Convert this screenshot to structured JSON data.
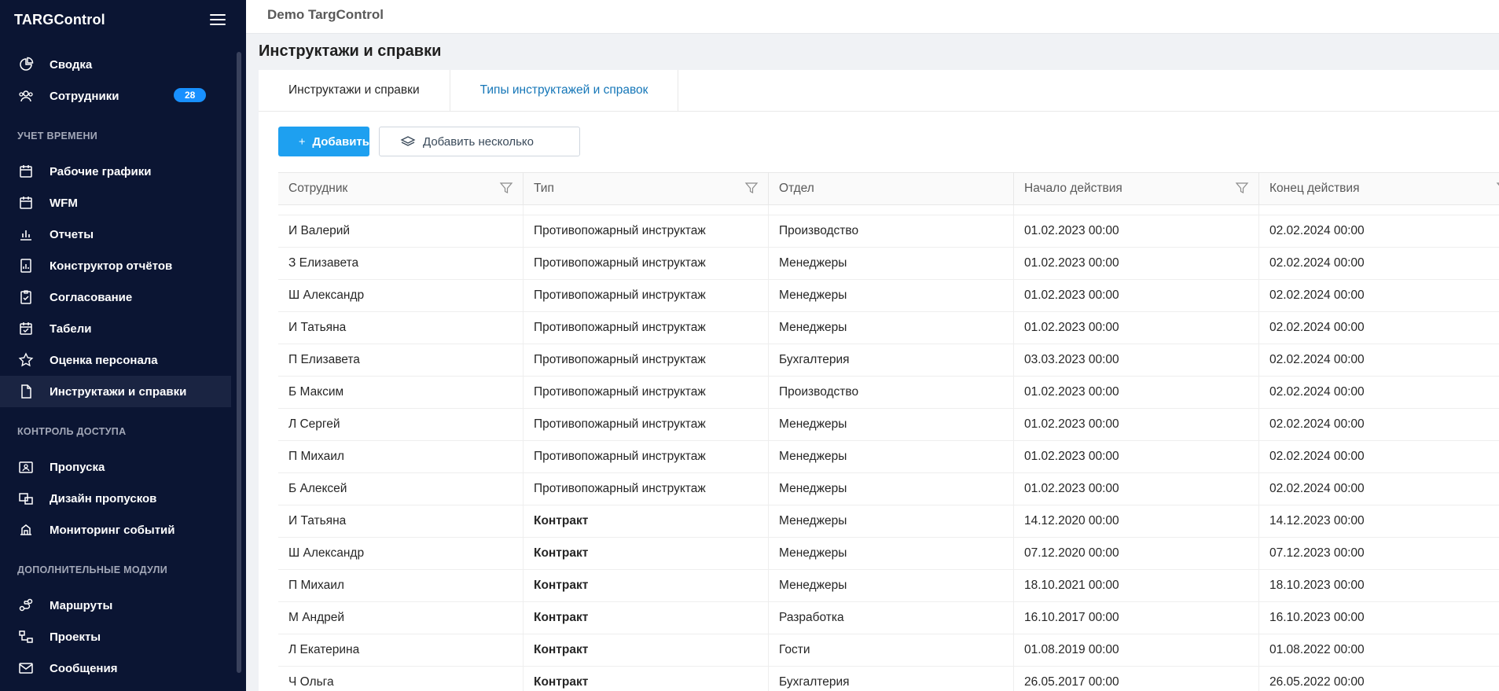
{
  "sidebar": {
    "logo": "TARGControl",
    "top_items": [
      {
        "label": "Сводка",
        "icon": "pie-chart-icon"
      },
      {
        "label": "Сотрудники",
        "icon": "users-icon",
        "badge": "28"
      }
    ],
    "sections": [
      {
        "title": "УЧЕТ ВРЕМЕНИ",
        "items": [
          {
            "label": "Рабочие графики",
            "icon": "calendar-icon"
          },
          {
            "label": "WFM",
            "icon": "calendar-icon"
          },
          {
            "label": "Отчеты",
            "icon": "bar-chart-icon"
          },
          {
            "label": "Конструктор отчётов",
            "icon": "report-builder-icon"
          },
          {
            "label": "Согласование",
            "icon": "checklist-icon"
          },
          {
            "label": "Табели",
            "icon": "calendar-check-icon"
          },
          {
            "label": "Оценка персонала",
            "icon": "star-icon"
          },
          {
            "label": "Инструктажи и справки",
            "icon": "document-icon"
          }
        ]
      },
      {
        "title": "КОНТРОЛЬ ДОСТУПА",
        "items": [
          {
            "label": "Пропуска",
            "icon": "id-card-icon"
          },
          {
            "label": "Дизайн пропусков",
            "icon": "design-icon"
          },
          {
            "label": "Мониторинг событий",
            "icon": "monitoring-icon"
          }
        ]
      },
      {
        "title": "ДОПОЛНИТЕЛЬНЫЕ МОДУЛИ",
        "items": [
          {
            "label": "Маршруты",
            "icon": "route-icon"
          },
          {
            "label": "Проекты",
            "icon": "project-icon"
          },
          {
            "label": "Сообщения",
            "icon": "mail-icon"
          }
        ]
      }
    ]
  },
  "header": {
    "app_name": "Demo TargControl"
  },
  "page": {
    "title": "Инструктажи и справки"
  },
  "tabs": [
    {
      "label": "Инструктажи и справки",
      "active": true
    },
    {
      "label": "Типы инструктажей и справок",
      "active": false
    }
  ],
  "toolbar": {
    "add_label": "Добавить",
    "add_many_label": "Добавить несколько"
  },
  "table": {
    "columns": [
      "Сотрудник",
      "Тип",
      "Отдел",
      "Начало действия",
      "Конец действия"
    ],
    "rows": [
      [
        "И Валерий",
        "Противопожарный инструктаж",
        "Производство",
        "01.02.2023 00:00",
        "02.02.2024 00:00"
      ],
      [
        "З Елизавета",
        "Противопожарный инструктаж",
        "Менеджеры",
        "01.02.2023 00:00",
        "02.02.2024 00:00"
      ],
      [
        "Ш Александр",
        "Противопожарный инструктаж",
        "Менеджеры",
        "01.02.2023 00:00",
        "02.02.2024 00:00"
      ],
      [
        "И Татьяна",
        "Противопожарный инструктаж",
        "Менеджеры",
        "01.02.2023 00:00",
        "02.02.2024 00:00"
      ],
      [
        "П Елизавета",
        "Противопожарный инструктаж",
        "Бухгалтерия",
        "03.03.2023 00:00",
        "02.02.2024 00:00"
      ],
      [
        "Б Максим",
        "Противопожарный инструктаж",
        "Производство",
        "01.02.2023 00:00",
        "02.02.2024 00:00"
      ],
      [
        "Л Сергей",
        "Противопожарный инструктаж",
        "Менеджеры",
        "01.02.2023 00:00",
        "02.02.2024 00:00"
      ],
      [
        "П Михаил",
        "Противопожарный инструктаж",
        "Менеджеры",
        "01.02.2023 00:00",
        "02.02.2024 00:00"
      ],
      [
        "Б Алексей",
        "Противопожарный инструктаж",
        "Менеджеры",
        "01.02.2023 00:00",
        "02.02.2024 00:00"
      ],
      [
        "И Татьяна",
        "Контракт",
        "Менеджеры",
        "14.12.2020 00:00",
        "14.12.2023 00:00"
      ],
      [
        "Ш Александр",
        "Контракт",
        "Менеджеры",
        "07.12.2020 00:00",
        "07.12.2023 00:00"
      ],
      [
        "П Михаил",
        "Контракт",
        "Менеджеры",
        "18.10.2021 00:00",
        "18.10.2023 00:00"
      ],
      [
        "М Андрей",
        "Контракт",
        "Разработка",
        "16.10.2017 00:00",
        "16.10.2023 00:00"
      ],
      [
        "Л Екатерина",
        "Контракт",
        "Гости",
        "01.08.2019 00:00",
        "01.08.2022 00:00"
      ],
      [
        "Ч Ольга",
        "Контракт",
        "Бухгалтерия",
        "26.05.2017 00:00",
        "26.05.2022 00:00"
      ]
    ]
  },
  "colors": {
    "sidebar_bg": "#0b1533",
    "accent": "#1ea0f0",
    "badge": "#1890ff"
  }
}
